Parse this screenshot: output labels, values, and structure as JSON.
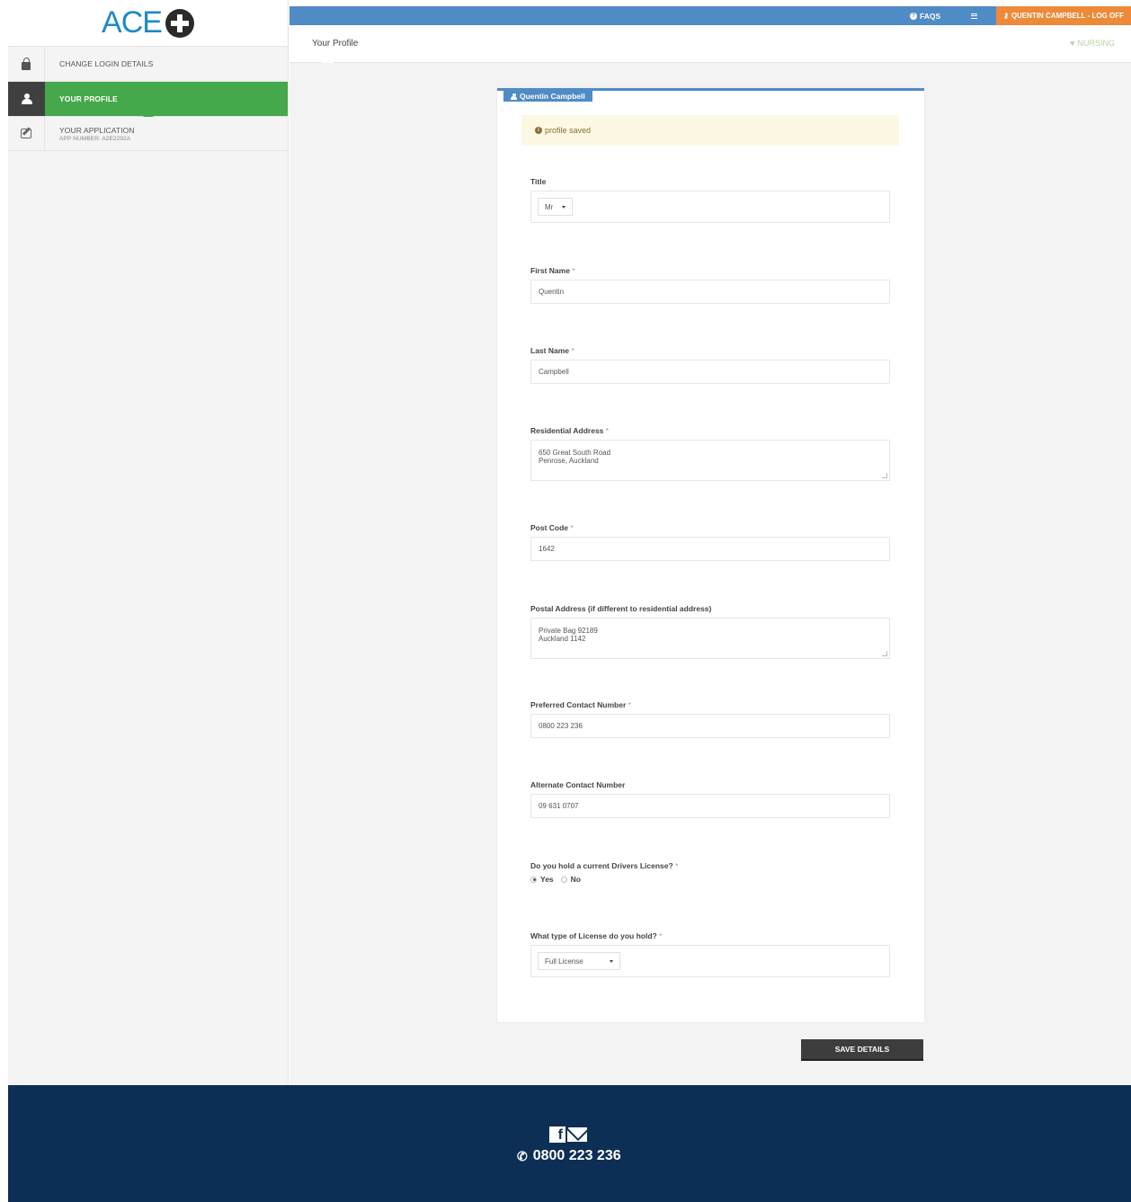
{
  "brand": {
    "logo_text": "ACE"
  },
  "sidebar": {
    "items": [
      {
        "label": "CHANGE LOGIN DETAILS",
        "icon": "lock-icon"
      },
      {
        "label": "YOUR PROFILE",
        "icon": "user-icon",
        "active": true
      },
      {
        "label": "YOUR APPLICATION",
        "sub": "APP NUMBER: A2E2292A",
        "icon": "edit-icon"
      }
    ]
  },
  "topbar": {
    "faqs_label": "FAQS",
    "logoff_label": "QUENTIN CAMPBELL - LOG OFF",
    "colors": {
      "bar": "#4f8bc4",
      "logoff": "#ec8a3a"
    }
  },
  "header": {
    "title": "Your Profile",
    "program": "NURSING"
  },
  "panel": {
    "tab_label": "Quentin Campbell",
    "alert": "profile saved"
  },
  "form": {
    "title": {
      "label": "Title",
      "value": "Mr"
    },
    "first_name": {
      "label": "First Name",
      "value": "Quentin"
    },
    "last_name": {
      "label": "Last Name",
      "value": "Campbell"
    },
    "residential_address": {
      "label": "Residential Address",
      "value": "650 Great South Road\nPenrose, Auckland"
    },
    "post_code": {
      "label": "Post Code",
      "value": "1642"
    },
    "postal_address": {
      "label": "Postal Address (if different to residential address)",
      "value": "Private Bag 92189\nAuckland 1142"
    },
    "preferred_contact": {
      "label": "Preferred Contact Number",
      "value": "0800 223 236"
    },
    "alternate_contact": {
      "label": "Alternate Contact Number",
      "value": "09 631 0707"
    },
    "drivers_license": {
      "label": "Do you hold a current Drivers License?",
      "yes": "Yes",
      "no": "No",
      "selected": "Yes"
    },
    "license_type": {
      "label": "What type of License do you hold?",
      "value": "Full License"
    },
    "required_marker": "*",
    "save_label": "SAVE DETAILS"
  },
  "footer": {
    "fb_glyph": "f",
    "phone": "0800 223 236",
    "background": "#0e2f55"
  }
}
